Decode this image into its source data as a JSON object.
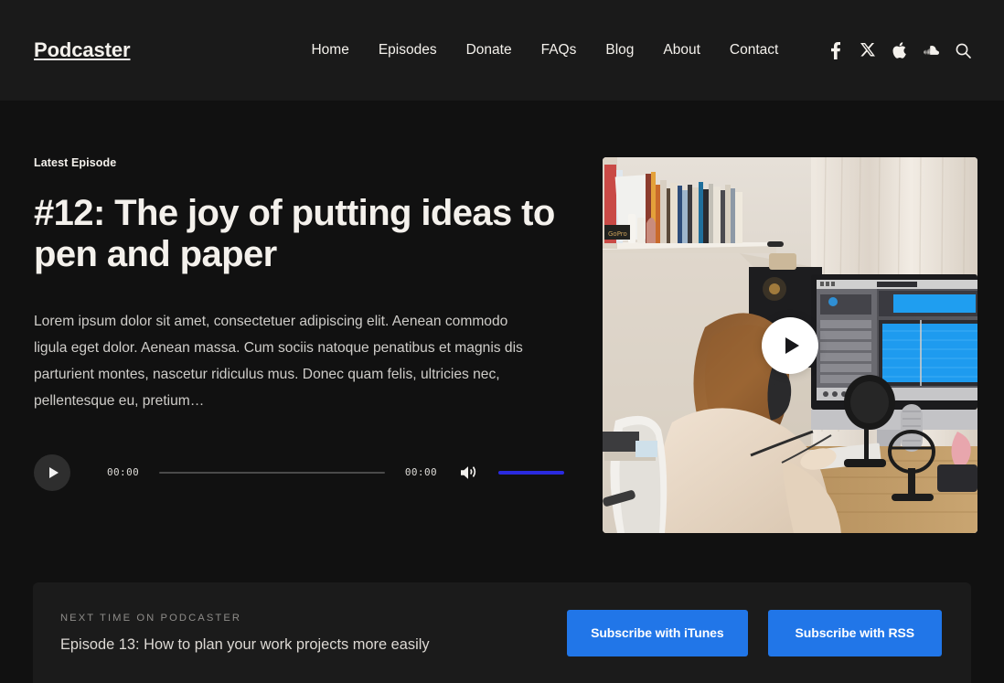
{
  "header": {
    "brand": "Podcaster",
    "nav": [
      {
        "label": "Home"
      },
      {
        "label": "Episodes"
      },
      {
        "label": "Donate"
      },
      {
        "label": "FAQs"
      },
      {
        "label": "Blog"
      },
      {
        "label": "About"
      },
      {
        "label": "Contact"
      }
    ],
    "social": [
      {
        "icon": "facebook-icon"
      },
      {
        "icon": "x-twitter-icon"
      },
      {
        "icon": "apple-icon"
      },
      {
        "icon": "soundcloud-icon"
      },
      {
        "icon": "search-icon"
      }
    ]
  },
  "hero": {
    "eyebrow": "Latest Episode",
    "title": "#12: The joy of putting ideas to pen and paper",
    "description": "Lorem ipsum dolor sit amet, consectetuer adipiscing elit. Aenean commodo ligula eget dolor. Aenean massa. Cum sociis natoque penatibus et magnis dis parturient montes, nascetur ridiculus mus. Donec quam felis, ultricies nec, pellentesque eu, pretium…",
    "player": {
      "current_time": "00:00",
      "duration": "00:00",
      "progress_percent": 0,
      "volume_percent": 100,
      "volume_color": "#2a2ae0"
    },
    "media": {
      "alt": "Woman seated at a desk editing audio on an iMac with a condenser microphone and pop filter, bookshelf above",
      "play_label": "Play"
    }
  },
  "next_banner": {
    "kicker": "NEXT TIME ON PODCASTER",
    "title": "Episode 13: How to plan your work projects more easily",
    "buttons": [
      {
        "label": "Subscribe with iTunes",
        "color": "#2176e8"
      },
      {
        "label": "Subscribe with RSS",
        "color": "#2176e8"
      }
    ]
  },
  "colors": {
    "header_bg": "#1a1a1a",
    "page_bg": "#111111",
    "banner_bg": "#1b1b1b",
    "text_primary": "#f4f1ec",
    "text_muted": "#cfcdc9",
    "accent_blue": "#2176e8"
  }
}
